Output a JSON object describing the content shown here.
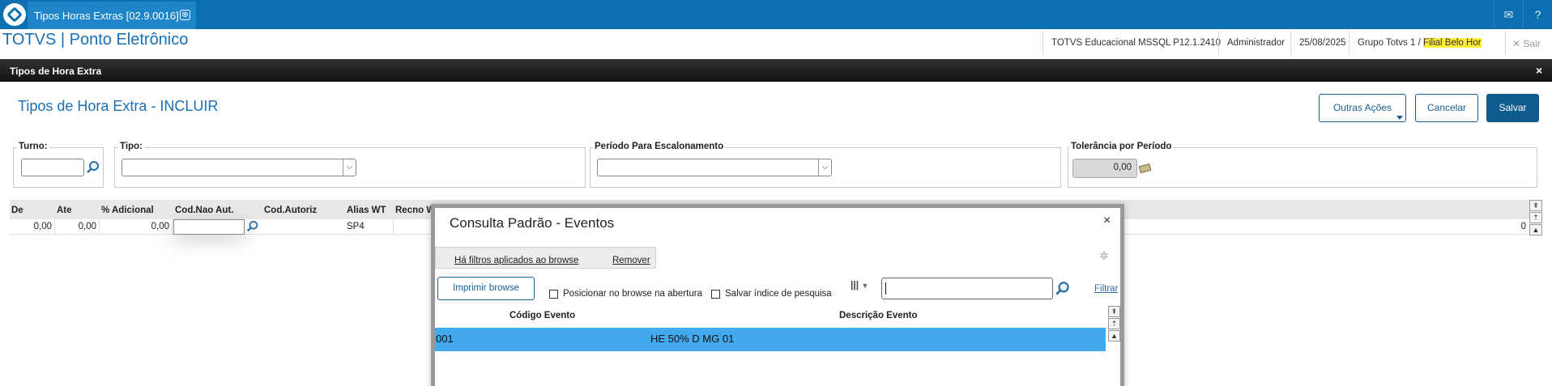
{
  "topbar": {
    "tab_label": "Tipos Horas Extras [02.9.0016]",
    "tab_close": "⊗",
    "mail_icon": "✉",
    "help_icon": "?"
  },
  "header": {
    "app_title": "TOTVS | Ponto Eletrônico",
    "environment": "TOTVS Educacional MSSQL P12.1.2410",
    "user": "Administrador",
    "date": "25/08/2025",
    "group_prefix": "Grupo Totvs 1 / ",
    "branch": "Filial Belo Hor",
    "exit_icon": "✕",
    "exit_label": "Sair"
  },
  "panel": {
    "title": "Tipos de Hora Extra",
    "close": "×"
  },
  "form": {
    "title": "Tipos de Hora Extra - INCLUIR",
    "buttons": {
      "other_actions": "Outras Ações",
      "cancel": "Cancelar",
      "save": "Salvar"
    },
    "fields": {
      "turno_label": "Turno:",
      "tipo_label": "Tipo:",
      "periodo_label": "Período Para Escalonamento",
      "tolerancia_label": "Tolerância por Período",
      "tolerancia_value": "0,00"
    }
  },
  "grid": {
    "columns": [
      "De",
      "Ate",
      "% Adicional",
      "Cod.Nao Aut.",
      "Cod.Autoriz",
      "Alias WT",
      "Recno W"
    ],
    "row": {
      "de": "0,00",
      "ate": "0,00",
      "adicional": "0,00",
      "cod_nao_aut": "",
      "cod_autoriz": "",
      "alias_wt": "SP4",
      "last": "0"
    },
    "scroll_buttons": [
      "⇞",
      "⇡",
      "▲"
    ]
  },
  "modal": {
    "title": "Consulta Padrão - Eventos",
    "close": "×",
    "filters_applied": "Há filtros aplicados ao browse",
    "remove": "Remover",
    "print_browse": "Imprimir browse",
    "position_on_open": "Posicionar no browse na abertura",
    "save_index": "Salvar índice de pesquisa",
    "search_value": "",
    "filter": "Filtrar",
    "columns_icon": "|||",
    "columns": [
      "Código Evento",
      "Descrição Evento"
    ],
    "rows": [
      {
        "codigo": "001",
        "descricao": "HE 50% D MG 01"
      }
    ],
    "scroll_buttons": [
      "⇞",
      "⇡",
      "▲"
    ]
  }
}
